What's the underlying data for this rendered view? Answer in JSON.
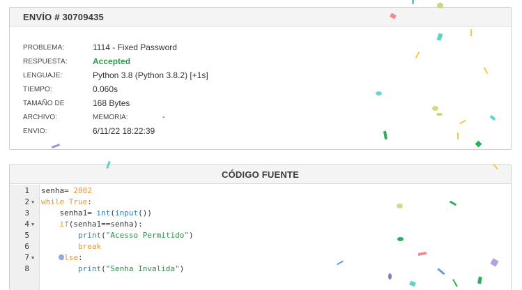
{
  "submission": {
    "title": "ENVÍO # 30709435",
    "rows": [
      {
        "label": "PROBLEMA:",
        "value": "1114 - Fixed Password"
      },
      {
        "label": "RESPUESTA:",
        "value": "Accepted"
      },
      {
        "label": "LENGUAJE:",
        "value": "Python 3.8 (Python 3.8.2) [+1s]"
      },
      {
        "label": "TIEMPO:",
        "value": "0.060s"
      },
      {
        "label": "TAMAÑO DE",
        "value": "168 Bytes"
      },
      {
        "label": "ARCHIVO:",
        "value": ""
      },
      {
        "label": "ENVIO:",
        "value": "6/11/22 18:22:39"
      }
    ],
    "memory_label": "MEMORIA:",
    "memory_value": "-"
  },
  "source": {
    "title": "CÓDIGO FUENTE",
    "line_numbers": [
      "1",
      "2",
      "3",
      "4",
      "5",
      "6",
      "7",
      "8"
    ],
    "lines": [
      "senha= 2002",
      "while True:",
      "    senha1= int(input())",
      "    if(senha1==senha):",
      "        print(\"Acesso Permitido\")",
      "        break",
      "    else:",
      "        print(\"Senha Invalida\")"
    ],
    "fold_lines": [
      2,
      4,
      7
    ]
  },
  "colors": {
    "accepted": "#2e9a4a",
    "keyword": "#e9952b",
    "string": "#2c8a4a",
    "function": "#2b7fc4"
  }
}
